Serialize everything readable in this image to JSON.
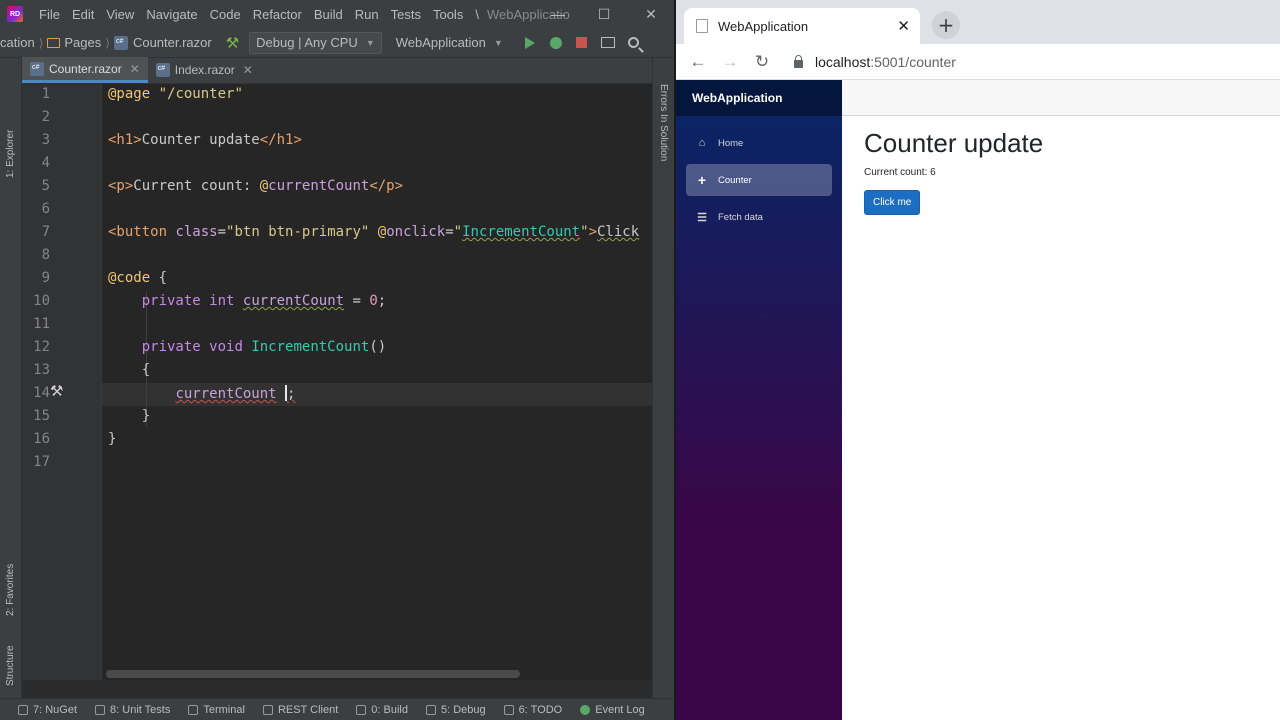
{
  "ide": {
    "menu": [
      "File",
      "Edit",
      "View",
      "Navigate",
      "Code",
      "Refactor",
      "Build",
      "Run",
      "Tests",
      "Tools",
      "\\"
    ],
    "window_title": "WebApplicatio",
    "toolbar": {
      "breadcrumb": [
        "cation",
        "Pages",
        "Counter.razor"
      ],
      "config": "Debug | Any CPU",
      "project": "WebApplication"
    },
    "left_strip": [
      "1: Explorer",
      "2: Favorites",
      "Structure"
    ],
    "right_strip": "Errors In Solution",
    "tabs": [
      {
        "label": "Counter.razor",
        "active": true
      },
      {
        "label": "Index.razor",
        "active": false
      }
    ],
    "line_numbers": [
      "1",
      "2",
      "3",
      "4",
      "5",
      "6",
      "7",
      "8",
      "9",
      "10",
      "11",
      "12",
      "13",
      "14",
      "15",
      "16",
      "17"
    ],
    "bottom_tabs": [
      "7: NuGet",
      "8: Unit Tests",
      "Terminal",
      "REST Client",
      "0: Build",
      "5: Debug",
      "6: TODO",
      "Event Log"
    ]
  },
  "browser": {
    "tab_title": "WebApplication",
    "url_host": "localhost",
    "url_path": ":5001/counter",
    "app_brand": "WebApplication",
    "nav": [
      {
        "label": "Home",
        "icon": "home-icon",
        "active": false
      },
      {
        "label": "Counter",
        "icon": "plus-icon",
        "active": true
      },
      {
        "label": "Fetch data",
        "icon": "list-icon",
        "active": false
      }
    ],
    "heading": "Counter update",
    "count_text": "Current count: 6",
    "button": "Click me"
  },
  "colors": {
    "accent": "#1b6ec2",
    "sidebar_top": "#052767",
    "sidebar_bottom": "#3a0647",
    "ide_bg": "#2b2b2b"
  }
}
